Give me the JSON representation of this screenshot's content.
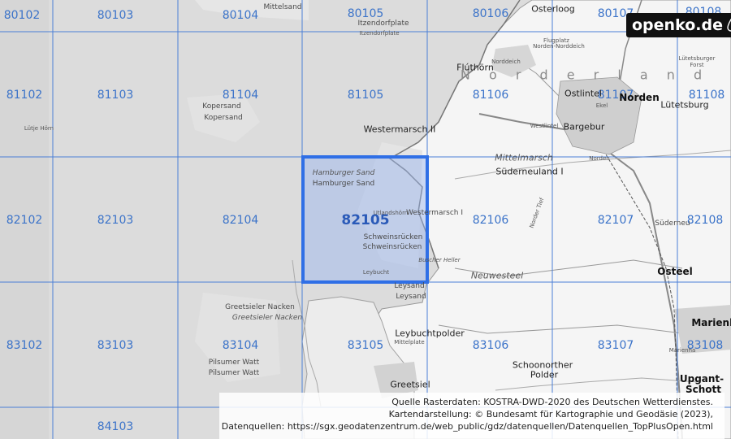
{
  "map": {
    "colors": {
      "sea": "#dcdcdc",
      "land": "#f4f4f4",
      "grid": "#4b7fd6",
      "highlight": "#2f6fe6",
      "highlight_fill": "rgba(150,180,240,0.45)"
    },
    "grid_labels": [
      {
        "id": "80102",
        "text": "80102"
      },
      {
        "id": "80103",
        "text": "80103"
      },
      {
        "id": "80104",
        "text": "80104"
      },
      {
        "id": "80105",
        "text": "80105"
      },
      {
        "id": "80106",
        "text": "80106"
      },
      {
        "id": "80107",
        "text": "80107"
      },
      {
        "id": "80108",
        "text": "80108"
      },
      {
        "id": "81102",
        "text": "81102"
      },
      {
        "id": "81103",
        "text": "81103"
      },
      {
        "id": "81104",
        "text": "81104"
      },
      {
        "id": "81105",
        "text": "81105"
      },
      {
        "id": "81106",
        "text": "81106"
      },
      {
        "id": "81107",
        "text": "81107"
      },
      {
        "id": "81108",
        "text": "81108"
      },
      {
        "id": "82102",
        "text": "82102"
      },
      {
        "id": "82103",
        "text": "82103"
      },
      {
        "id": "82104",
        "text": "82104"
      },
      {
        "id": "82105",
        "text": "82105"
      },
      {
        "id": "82106",
        "text": "82106"
      },
      {
        "id": "82107",
        "text": "82107"
      },
      {
        "id": "82108",
        "text": "82108"
      },
      {
        "id": "83102",
        "text": "83102"
      },
      {
        "id": "83103",
        "text": "83103"
      },
      {
        "id": "83104",
        "text": "83104"
      },
      {
        "id": "83105",
        "text": "83105"
      },
      {
        "id": "83106",
        "text": "83106"
      },
      {
        "id": "83107",
        "text": "83107"
      },
      {
        "id": "83108",
        "text": "83108"
      },
      {
        "id": "84103",
        "text": "84103"
      }
    ],
    "selected_cell": "82105",
    "places": [
      {
        "id": "mittelsand",
        "text": "Mittelsand"
      },
      {
        "id": "itzendorfplate-1",
        "text": "Itzendorfplate"
      },
      {
        "id": "itzendorfplate-2",
        "text": "Itzendorfplate"
      },
      {
        "id": "osterloog",
        "text": "Osterloog"
      },
      {
        "id": "flugplatz",
        "text": "Flugplatz"
      },
      {
        "id": "flugplatz-2",
        "text": "Norden-Norddeich"
      },
      {
        "id": "norddeich",
        "text": "Norddeich"
      },
      {
        "id": "fluthoern",
        "text": "Flúthörn"
      },
      {
        "id": "norderland",
        "text": "N o r d e r l a n d"
      },
      {
        "id": "luetetsburger",
        "text": "Lütetsburger"
      },
      {
        "id": "luetetsburger-2",
        "text": "Forst"
      },
      {
        "id": "ostlintel",
        "text": "Ostlintel"
      },
      {
        "id": "norden",
        "text": "Norden"
      },
      {
        "id": "luetetsburg",
        "text": "Lütetsburg"
      },
      {
        "id": "ekel",
        "text": "Ekel"
      },
      {
        "id": "kopersand-1",
        "text": "Kopersand"
      },
      {
        "id": "kopersand-2",
        "text": "Kopersand"
      },
      {
        "id": "luetje-hoern",
        "text": "Lütje Hörn"
      },
      {
        "id": "westermarsch-2",
        "text": "Westermarsch II"
      },
      {
        "id": "westlintel",
        "text": "Westlintel"
      },
      {
        "id": "bargebur",
        "text": "Bargebur"
      },
      {
        "id": "mittelmarsch",
        "text": "Mittelmarsch"
      },
      {
        "id": "norden-station",
        "text": "Norden"
      },
      {
        "id": "hamburger-sand-1",
        "text": "Hamburger Sand"
      },
      {
        "id": "hamburger-sand-2",
        "text": "Hamburger Sand"
      },
      {
        "id": "suederneuland",
        "text": "Süderneuland I"
      },
      {
        "id": "utlandshoern",
        "text": "Utlandshörn"
      },
      {
        "id": "westermarsch-1",
        "text": "Westermarsch I"
      },
      {
        "id": "norder-tief",
        "text": "Norder Tief"
      },
      {
        "id": "suederneuland-2",
        "text": "Süderneu"
      },
      {
        "id": "schweinsruecken-1",
        "text": "Schweinsrücken"
      },
      {
        "id": "schweinsruecken-2",
        "text": "Schweinsrücken"
      },
      {
        "id": "buscher-heller",
        "text": "Buscher Heller"
      },
      {
        "id": "leybucht",
        "text": "Leybucht"
      },
      {
        "id": "neuwesteel",
        "text": "Neuwesteel"
      },
      {
        "id": "osteel",
        "text": "Osteel"
      },
      {
        "id": "leysand-1",
        "text": "Leysand"
      },
      {
        "id": "leysand-2",
        "text": "Leysand"
      },
      {
        "id": "greetsieler-nacken-1",
        "text": "Greetsieler Nacken"
      },
      {
        "id": "greetsieler-nacken-2",
        "text": "Greetsieler Nacken"
      },
      {
        "id": "leybuchtpolder",
        "text": "Leybuchtpolder"
      },
      {
        "id": "mittelplate",
        "text": "Mittelplate"
      },
      {
        "id": "marienhafe",
        "text": "Marienh"
      },
      {
        "id": "marienhafe-station",
        "text": "Marienha"
      },
      {
        "id": "pilsumer-watt-1",
        "text": "Pilsumer Watt"
      },
      {
        "id": "pilsumer-watt-2",
        "text": "Pilsumer Watt"
      },
      {
        "id": "schoonorther",
        "text": "Schoonorther"
      },
      {
        "id": "schoonorther-2",
        "text": "Polder"
      },
      {
        "id": "upgant",
        "text": "Upgant-"
      },
      {
        "id": "upgant-2",
        "text": "Schott"
      },
      {
        "id": "greetsiel",
        "text": "Greetsiel"
      }
    ],
    "logo": "openko.de",
    "attribution": [
      "Quelle Rasterdaten: KOSTRA-DWD-2020 des Deutschen Wetterdienstes.",
      "Kartendarstellung: © Bundesamt für Kartographie und Geodäsie (2023),",
      "Datenquellen: https://sgx.geodatenzentrum.de/web_public/gdz/datenquellen/Datenquellen_TopPlusOpen.html"
    ]
  }
}
